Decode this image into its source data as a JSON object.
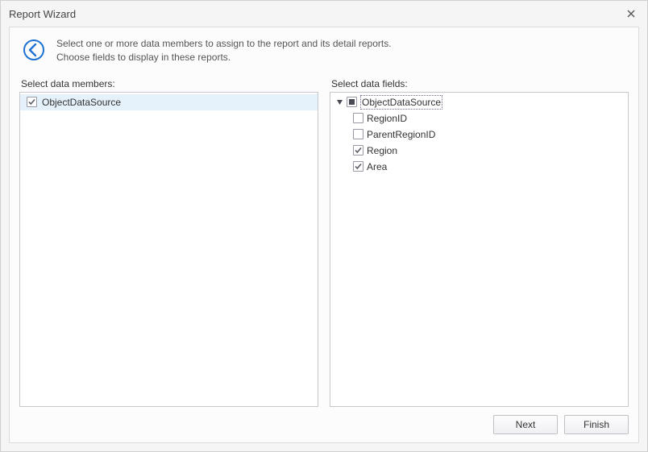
{
  "window": {
    "title": "Report Wizard"
  },
  "instructions": {
    "line1": "Select one or more data members to assign to the report and its detail reports.",
    "line2": "Choose fields to display in these reports."
  },
  "labels": {
    "members": "Select data members:",
    "fields": "Select data fields:"
  },
  "members": {
    "items": [
      {
        "label": "ObjectDataSource",
        "checked": true,
        "selected": true
      }
    ]
  },
  "fields": {
    "root": {
      "label": "ObjectDataSource",
      "state": "indeterminate",
      "focused": true
    },
    "children": [
      {
        "label": "RegionID",
        "checked": false
      },
      {
        "label": "ParentRegionID",
        "checked": false
      },
      {
        "label": "Region",
        "checked": true
      },
      {
        "label": "Area",
        "checked": true
      }
    ]
  },
  "buttons": {
    "next": "Next",
    "finish": "Finish"
  },
  "colors": {
    "accent": "#1e73d2",
    "selectionBg": "#e6f2fb"
  }
}
